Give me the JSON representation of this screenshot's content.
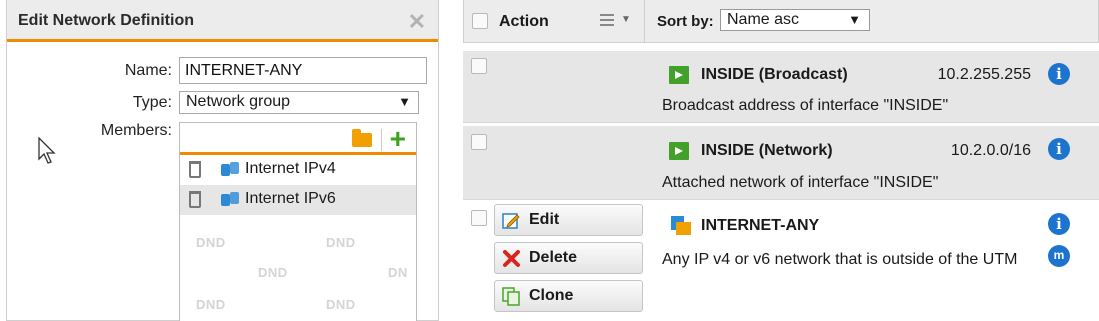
{
  "dialog": {
    "title": "Edit Network Definition",
    "close_icon": "close-icon",
    "fields": {
      "name_label": "Name:",
      "name_value": "INTERNET-ANY",
      "type_label": "Type:",
      "type_value": "Network group",
      "members_label": "Members:"
    },
    "members": [
      {
        "label": "Internet IPv4",
        "icon": "network-icon"
      },
      {
        "label": "Internet IPv6",
        "icon": "network-icon"
      }
    ],
    "dnd_text": "DND",
    "dnd_text_cut": "DN"
  },
  "list": {
    "header": {
      "action_label": "Action",
      "sort_label": "Sort by:",
      "sort_value": "Name asc"
    },
    "items": [
      {
        "title": "INSIDE (Broadcast)",
        "address": "10.2.255.255",
        "description": "Broadcast address of interface \"INSIDE\""
      },
      {
        "title": "INSIDE (Network)",
        "address": "10.2.0.0/16",
        "description": "Attached network of interface \"INSIDE\""
      },
      {
        "title": "INTERNET-ANY",
        "address": "",
        "description": "Any IP v4 or v6 network that is outside of the UTM",
        "actions": {
          "edit": "Edit",
          "delete": "Delete",
          "clone": "Clone"
        }
      }
    ],
    "info_glyph": "i",
    "m_glyph": "m"
  },
  "colors": {
    "accent": "#f08a00",
    "info": "#1d74cf",
    "interface": "#43a02a"
  }
}
